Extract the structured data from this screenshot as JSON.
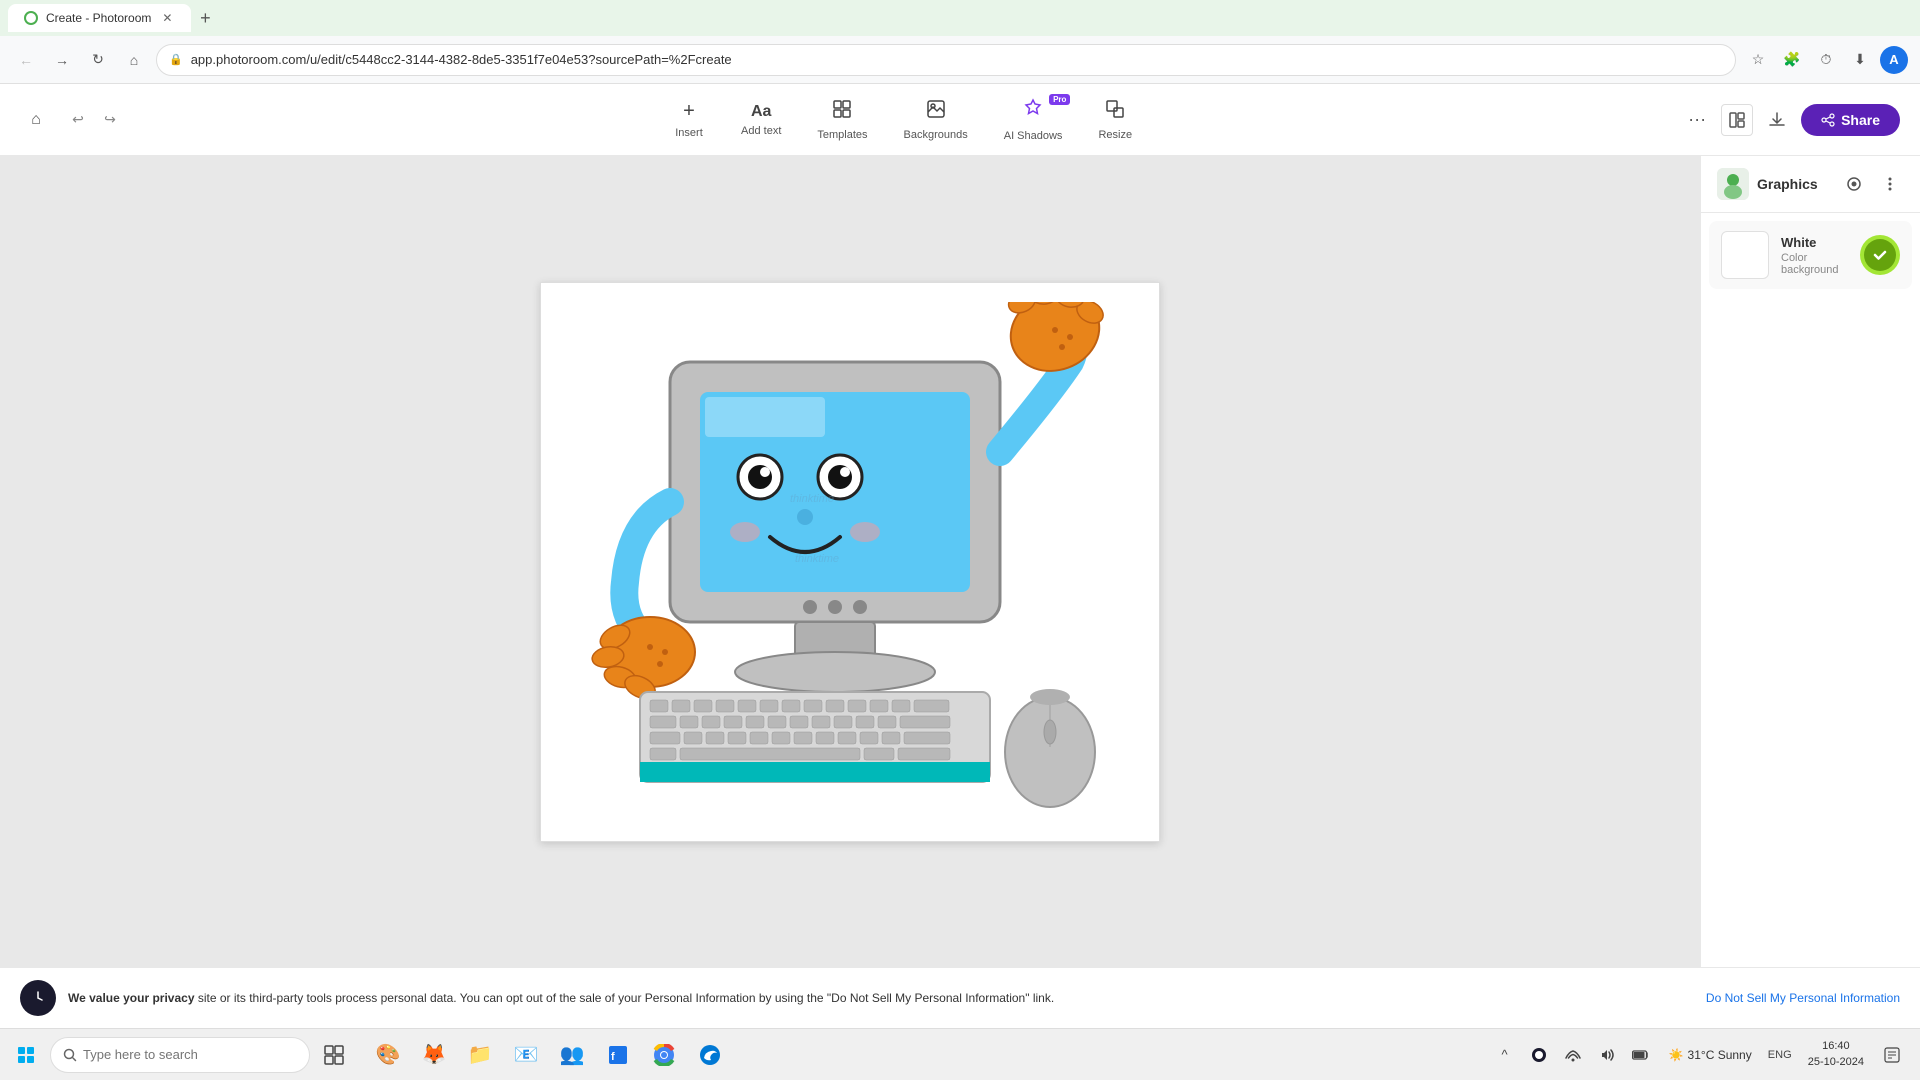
{
  "browser": {
    "tab": {
      "title": "Create - Photoroom",
      "favicon_color": "#4CAF50"
    },
    "address": "app.photoroom.com/u/edit/c5448cc2-3144-4382-8de5-3351f7e04e53?sourcePath=%2Fcreate",
    "toolbar_icons": [
      "bookmark",
      "extensions",
      "history",
      "download-icon",
      "profile"
    ]
  },
  "app": {
    "toolbar": {
      "tools": [
        {
          "id": "insert",
          "icon": "+",
          "label": "Insert",
          "pro": false
        },
        {
          "id": "add-text",
          "icon": "Aa",
          "label": "Add text",
          "pro": false
        },
        {
          "id": "templates",
          "icon": "📄",
          "label": "Templates",
          "pro": false
        },
        {
          "id": "backgrounds",
          "icon": "🖼",
          "label": "Backgrounds",
          "pro": false
        },
        {
          "id": "ai-shadows",
          "icon": "✦",
          "label": "AI Shadows",
          "pro": true
        },
        {
          "id": "resize",
          "icon": "⊞",
          "label": "Resize",
          "pro": false
        }
      ],
      "share_label": "Share",
      "more_label": "···"
    }
  },
  "panel": {
    "title": "Graphics",
    "avatar_emoji": "🎨",
    "items": [
      {
        "id": "white-bg",
        "name": "White",
        "subtitle": "Color background",
        "swatch_color": "#ffffff",
        "action_color": "#a3e635"
      }
    ]
  },
  "privacy_banner": {
    "title": "We value your privacy",
    "text": " site or its third-party tools process personal data. You can opt out of the sale of your Personal Information by using the \"Do Not Sell My Personal Information\" link.",
    "link_text": "Do Not Sell My Personal Information"
  },
  "taskbar": {
    "search_placeholder": "Type here to search",
    "weather": "31°C  Sunny",
    "time": "16:40",
    "date": "25-10-2024",
    "lang": "ENG",
    "apps": [
      "⊞",
      "🔍",
      "📋",
      "🎨",
      "🦊",
      "📁",
      "📧",
      "👥",
      "📊",
      "🌐",
      "🎭",
      "🌀"
    ]
  }
}
